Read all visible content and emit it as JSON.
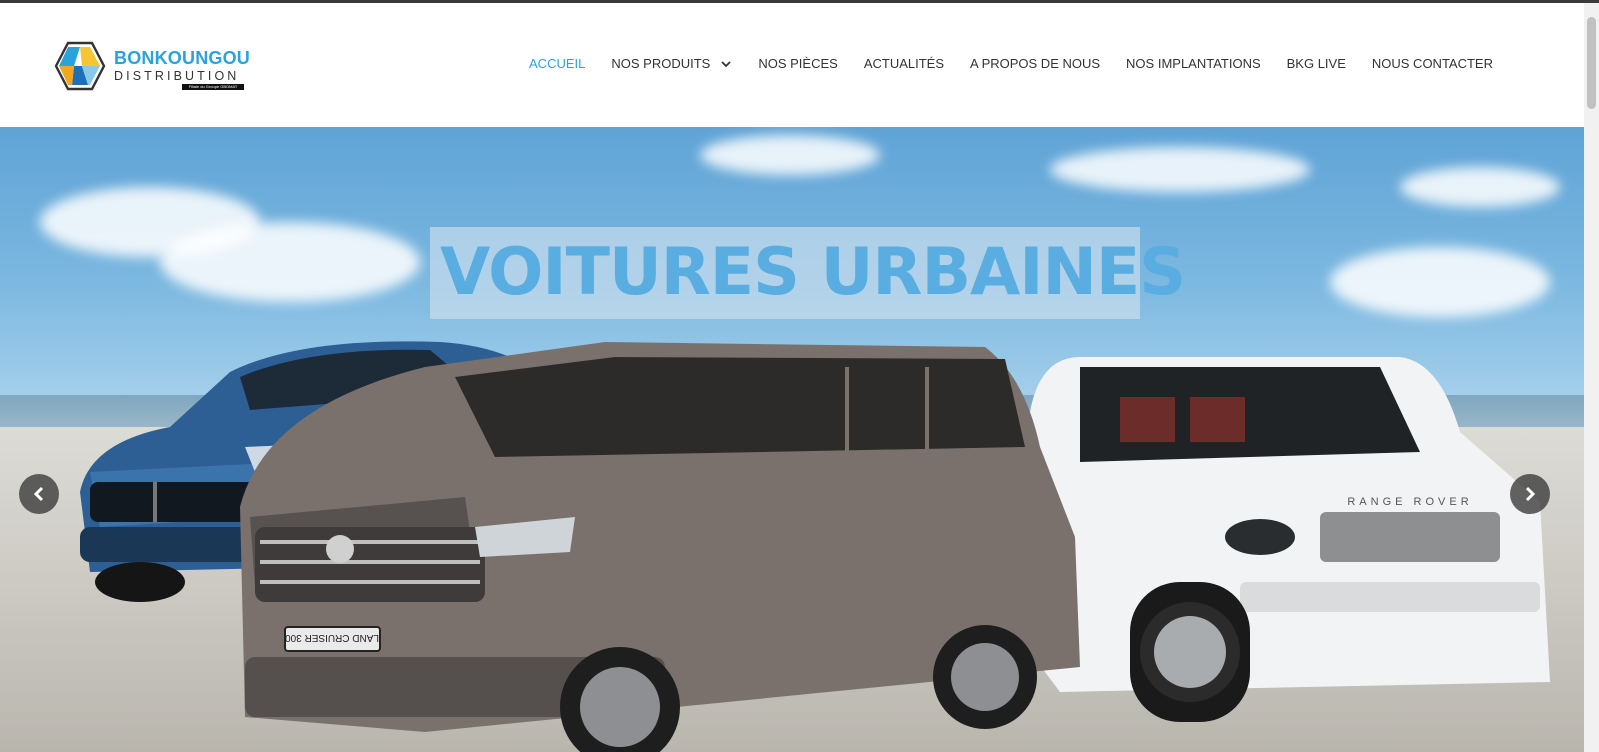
{
  "brand": {
    "name_main": "BONKOUNGOU",
    "name_sub": "DISTRIBUTION",
    "badge": "Filiale du Groupe GBOMAT",
    "accent_color": "#29a3dc"
  },
  "nav": {
    "items": [
      {
        "label": "ACCUEIL",
        "active": true
      },
      {
        "label": "NOS PRODUITS",
        "has_dropdown": true
      },
      {
        "label": "NOS PIÈCES"
      },
      {
        "label": "ACTUALITÉS"
      },
      {
        "label": "A PROPOS DE NOUS"
      },
      {
        "label": "NOS IMPLANTATIONS"
      },
      {
        "label": "BKG LIVE"
      },
      {
        "label": "NOUS CONTACTER"
      }
    ]
  },
  "hero": {
    "title": "VOITURES URBAINES",
    "plate_text": "LAND CRUISER 300",
    "grille_text": "RANGE ROVER",
    "icons": {
      "prev": "chevron-left-icon",
      "next": "chevron-right-icon"
    }
  }
}
